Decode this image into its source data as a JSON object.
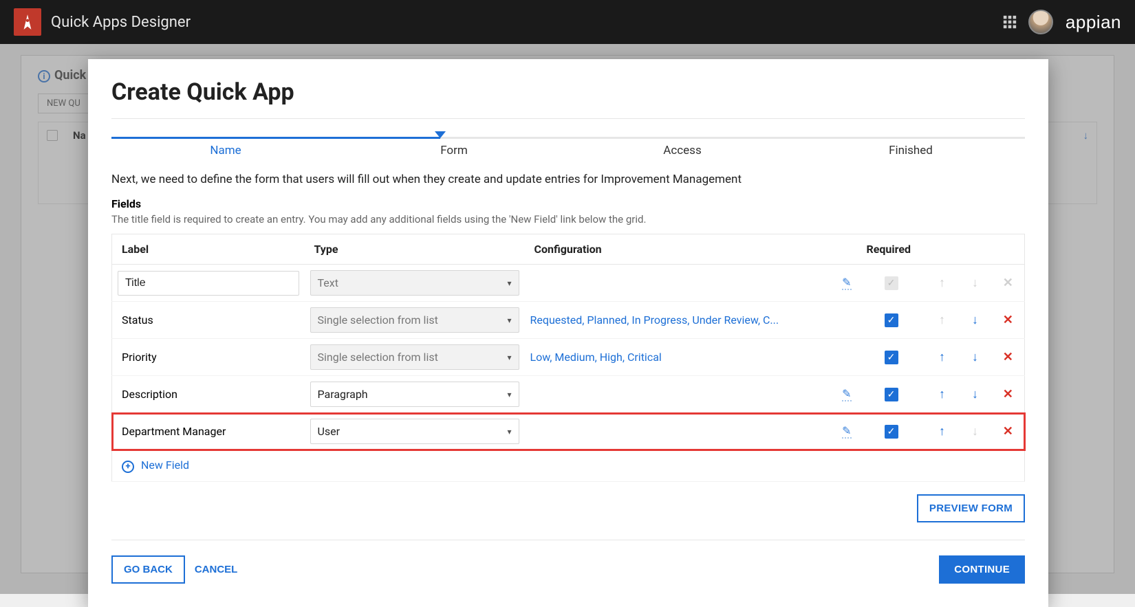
{
  "topbar": {
    "brand_title": "Quick Apps Designer",
    "vendor_word": "appian"
  },
  "background": {
    "title_prefix": "Quick",
    "new_button": "NEW QU",
    "col_name": "Na"
  },
  "modal": {
    "title": "Create Quick App",
    "steps": [
      "Name",
      "Form",
      "Access",
      "Finished"
    ],
    "active_step_index": 1,
    "instruction": "Next, we need to define the form that users will fill out when they create and update entries for Improvement Management",
    "fields_heading": "Fields",
    "fields_help": "The title field is required to create an entry. You may add any additional fields using the 'New Field' link below the grid.",
    "columns": {
      "label": "Label",
      "type": "Type",
      "config": "Configuration",
      "required": "Required"
    },
    "rows": [
      {
        "label": "Title",
        "label_editable": true,
        "type": "Text",
        "type_disabled": true,
        "config_text": "",
        "config_editable": true,
        "required": true,
        "required_locked": true,
        "up": false,
        "down": false,
        "delete": false
      },
      {
        "label": "Status",
        "label_editable": false,
        "type": "Single selection from list",
        "type_disabled": true,
        "config_text": "Requested, Planned, In Progress, Under Review, C...",
        "config_editable": false,
        "required": true,
        "up": false,
        "down": true,
        "delete": true
      },
      {
        "label": "Priority",
        "label_editable": false,
        "type": "Single selection from list",
        "type_disabled": true,
        "config_text": "Low, Medium, High, Critical",
        "config_editable": false,
        "required": true,
        "up": true,
        "down": true,
        "delete": true
      },
      {
        "label": "Description",
        "label_editable": false,
        "type": "Paragraph",
        "type_disabled": false,
        "config_text": "",
        "config_editable": true,
        "required": true,
        "up": true,
        "down": true,
        "delete": true
      },
      {
        "label": "Department Manager",
        "label_editable": false,
        "type": "User",
        "type_disabled": false,
        "config_text": "",
        "config_editable": true,
        "required": true,
        "up": true,
        "down": false,
        "delete": true,
        "highlight": true
      }
    ],
    "new_field": "New Field",
    "preview": "PREVIEW FORM",
    "go_back": "GO BACK",
    "cancel": "CANCEL",
    "continue": "CONTINUE"
  }
}
